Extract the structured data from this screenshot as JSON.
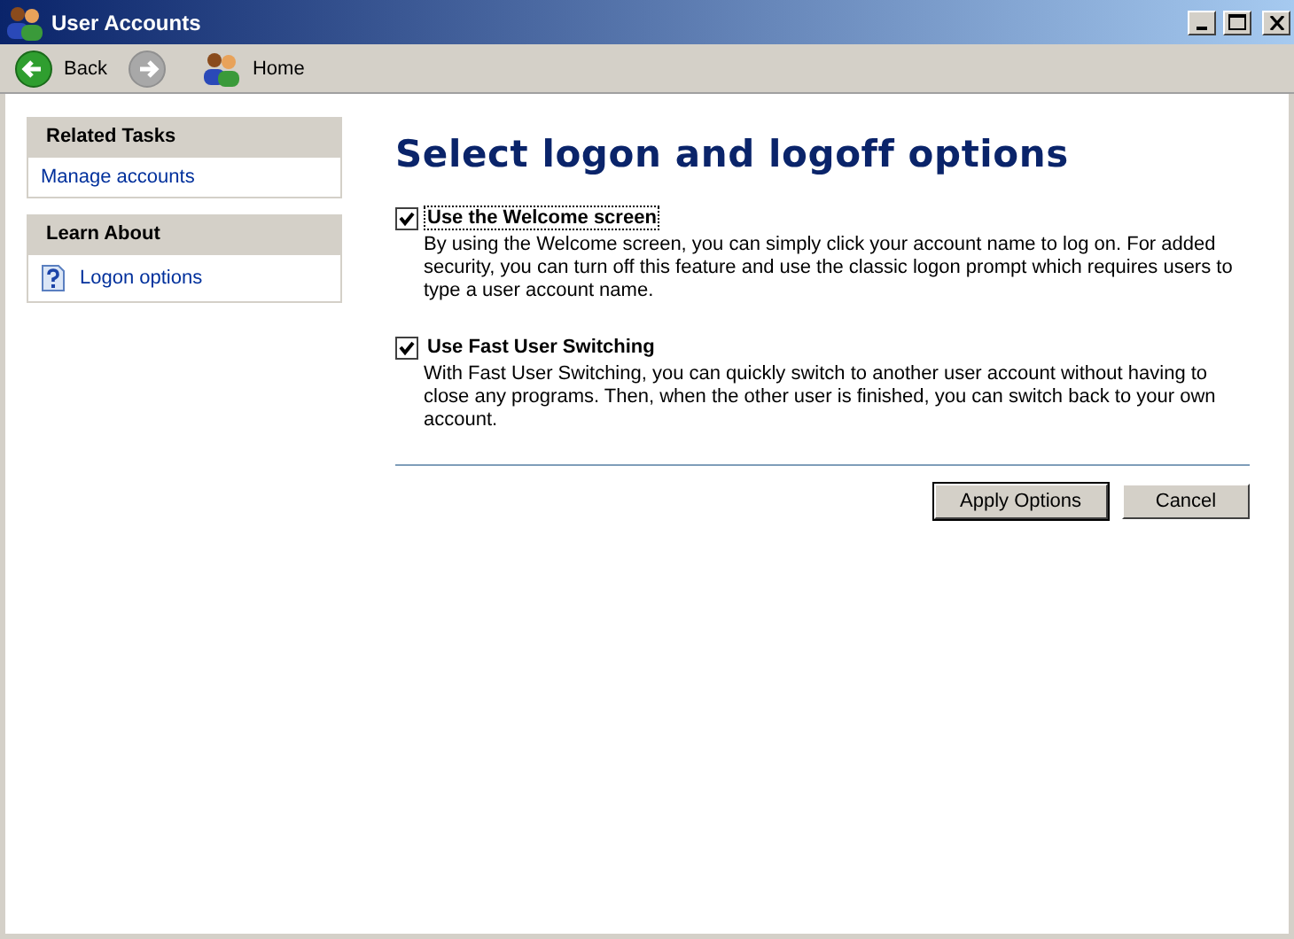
{
  "window": {
    "title": "User Accounts"
  },
  "toolbar": {
    "back": {
      "label": "Back",
      "disabled": false
    },
    "forward": {
      "disabled": true
    },
    "home": {
      "label": "Home"
    }
  },
  "sidebar": [
    {
      "title": "Related Tasks",
      "items": [
        {
          "label": "Manage accounts",
          "kind": "link"
        }
      ]
    },
    {
      "title": "Learn About",
      "items": [
        {
          "label": "Logon options",
          "kind": "help"
        }
      ]
    }
  ],
  "heading": "Select logon and logoff options",
  "options": [
    {
      "label": "Use the Welcome screen",
      "checked": true,
      "focused": true,
      "description": "By using the Welcome screen, you can simply click your account name to log on. For added security, you can turn off this feature and use the classic logon prompt which requires users to type a user account name."
    },
    {
      "label": "Use Fast User Switching",
      "checked": true,
      "focused": false,
      "description": "With Fast User Switching, you can quickly switch to another user account without having to close any programs. Then, when the other user is finished, you can switch back to your own account."
    }
  ],
  "buttons": [
    "Apply Options",
    "Cancel"
  ]
}
